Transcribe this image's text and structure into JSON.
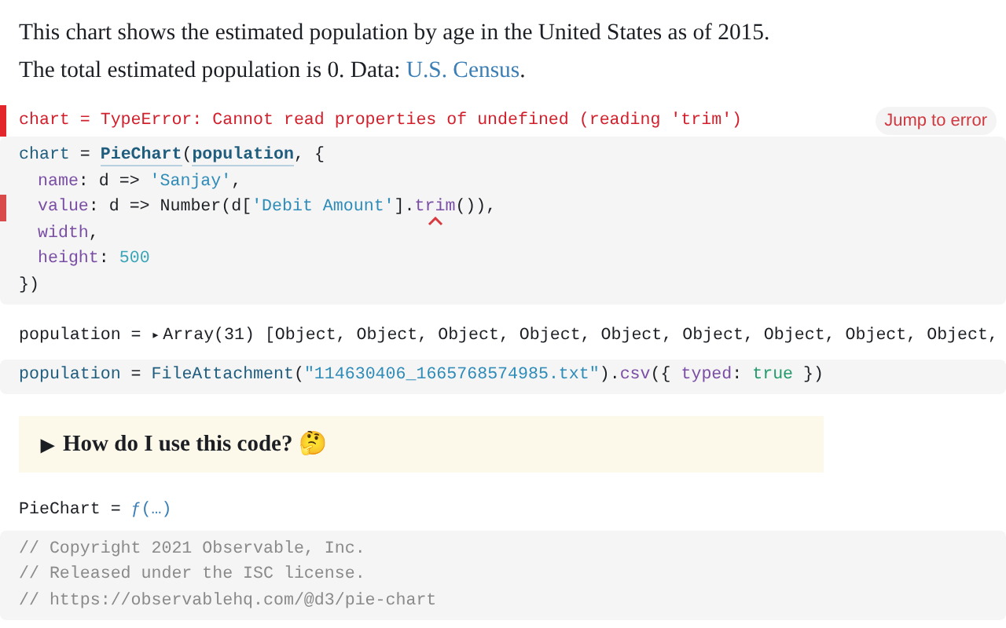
{
  "intro": {
    "lines": [
      "This chart shows the estimated population by age in the United States as of 2015.",
      "The total estimated population is 0. Data: "
    ],
    "link": "U.S. Census",
    "after_link": "."
  },
  "error_output": {
    "text": "chart = TypeError: Cannot read properties of undefined (reading 'trim')",
    "button": "Jump to error"
  },
  "chart_cell": {
    "lines": [
      {
        "error": false,
        "tokens": [
          {
            "kind": "def",
            "text": "chart"
          },
          {
            "kind": "plain",
            "text": " = "
          },
          {
            "kind": "ref",
            "text": "PieChart"
          },
          {
            "kind": "plain",
            "text": "("
          },
          {
            "kind": "ref",
            "text": "population"
          },
          {
            "kind": "plain",
            "text": ", {"
          }
        ]
      },
      {
        "error": false,
        "indent": true,
        "tokens": [
          {
            "kind": "prop",
            "text": "name"
          },
          {
            "kind": "plain",
            "text": ": d => "
          },
          {
            "kind": "str",
            "text": "'Sanjay'"
          },
          {
            "kind": "plain",
            "text": ","
          }
        ]
      },
      {
        "error": true,
        "indent": true,
        "tokens": [
          {
            "kind": "prop",
            "text": "value"
          },
          {
            "kind": "plain",
            "text": ": d => Number(d["
          },
          {
            "kind": "str",
            "text": "'Debit Amount'"
          },
          {
            "kind": "plain",
            "text": "]."
          },
          {
            "kind": "prop",
            "text": "trim",
            "flagged": true
          },
          {
            "kind": "plain",
            "text": "()),"
          }
        ]
      },
      {
        "error": false,
        "indent": true,
        "tokens": [
          {
            "kind": "prop",
            "text": "width"
          },
          {
            "kind": "plain",
            "text": ","
          }
        ]
      },
      {
        "error": false,
        "indent": true,
        "tokens": [
          {
            "kind": "prop",
            "text": "height"
          },
          {
            "kind": "plain",
            "text": ": "
          },
          {
            "kind": "num",
            "text": "500"
          }
        ]
      },
      {
        "error": false,
        "tokens": [
          {
            "kind": "plain",
            "text": "})"
          }
        ]
      }
    ]
  },
  "population_output": {
    "text": "population = ",
    "toggle": "▸",
    "value": "Array(31) [Object, Object, Object, Object, Object, Object, Object, Object, Object,"
  },
  "population_cell": {
    "lines": [
      {
        "error": false,
        "tokens": [
          {
            "kind": "def",
            "text": "population"
          },
          {
            "kind": "plain",
            "text": " = "
          },
          {
            "kind": "fn",
            "text": "FileAttachment"
          },
          {
            "kind": "plain",
            "text": "("
          },
          {
            "kind": "str",
            "text": "\"114630406_1665768574985.txt\""
          },
          {
            "kind": "plain",
            "text": ")."
          },
          {
            "kind": "prop",
            "text": "csv"
          },
          {
            "kind": "plain",
            "text": "({ "
          },
          {
            "kind": "prop",
            "text": "typed"
          },
          {
            "kind": "plain",
            "text": ": "
          },
          {
            "kind": "bool",
            "text": "true"
          },
          {
            "kind": "plain",
            "text": " })"
          }
        ]
      }
    ]
  },
  "details": {
    "toggle": "▶",
    "summary": "How do I use this code? 🤔",
    "expanded": false
  },
  "piechart_output": {
    "text": "PieChart = ",
    "value": "ƒ(…)"
  },
  "piechart_cell": {
    "lines": [
      {
        "error": false,
        "tokens": [
          {
            "kind": "comment",
            "text": "// Copyright 2021 Observable, Inc."
          }
        ]
      },
      {
        "error": false,
        "tokens": [
          {
            "kind": "comment",
            "text": "// Released under the ISC license."
          }
        ]
      },
      {
        "error": false,
        "tokens": [
          {
            "kind": "comment",
            "text": "// https://observablehq.com/@d3/pie-chart"
          }
        ]
      }
    ]
  }
}
